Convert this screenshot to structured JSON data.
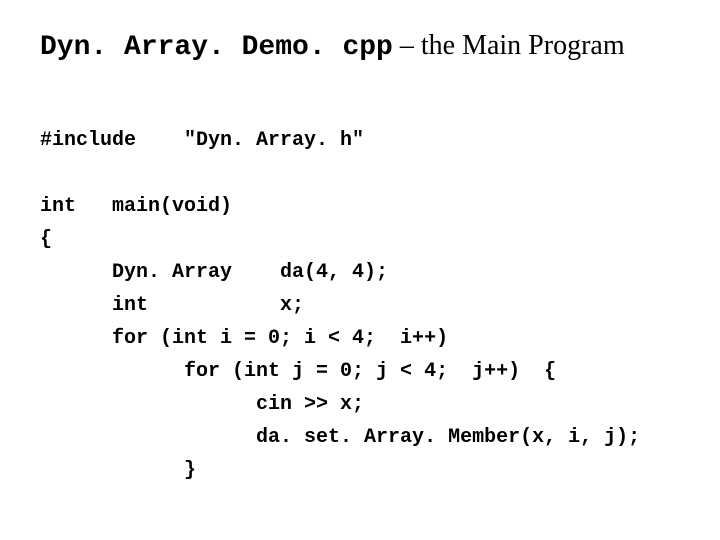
{
  "title": {
    "mono": "Dyn. Array. Demo. cpp",
    "serif": " – the Main Program"
  },
  "code": {
    "line1": "#include    \"Dyn. Array. h\"",
    "line2": "",
    "line3": "int   main(void)",
    "line4": "{",
    "line5": "      Dyn. Array    da(4, 4);",
    "line6": "      int           x;",
    "line7": "      for (int i = 0; i < 4;  i++)",
    "line8": "            for (int j = 0; j < 4;  j++)  {",
    "line9": "                  cin >> x;",
    "line10": "                  da. set. Array. Member(x, i, j);",
    "line11": "            }"
  }
}
